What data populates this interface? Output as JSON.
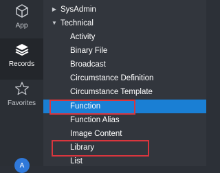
{
  "rail": {
    "items": [
      {
        "label": "App",
        "icon": "cube-icon"
      },
      {
        "label": "Records",
        "icon": "layers-icon",
        "active": true
      },
      {
        "label": "Favorites",
        "icon": "star-icon"
      }
    ],
    "avatar": "A"
  },
  "tree": {
    "groups": [
      {
        "label": "SysAdmin",
        "expanded": false
      },
      {
        "label": "Technical",
        "expanded": true
      }
    ],
    "items": [
      {
        "label": "Activity"
      },
      {
        "label": "Binary File"
      },
      {
        "label": "Broadcast"
      },
      {
        "label": "Circumstance Definition"
      },
      {
        "label": "Circumstance Template"
      },
      {
        "label": "Function",
        "selected": true,
        "highlighted": true
      },
      {
        "label": "Function Alias"
      },
      {
        "label": "Image Content"
      },
      {
        "label": "Library",
        "highlighted": true
      },
      {
        "label": "List"
      }
    ],
    "selected_color": "#1a7fd4",
    "highlight_color": "#d9363e"
  }
}
